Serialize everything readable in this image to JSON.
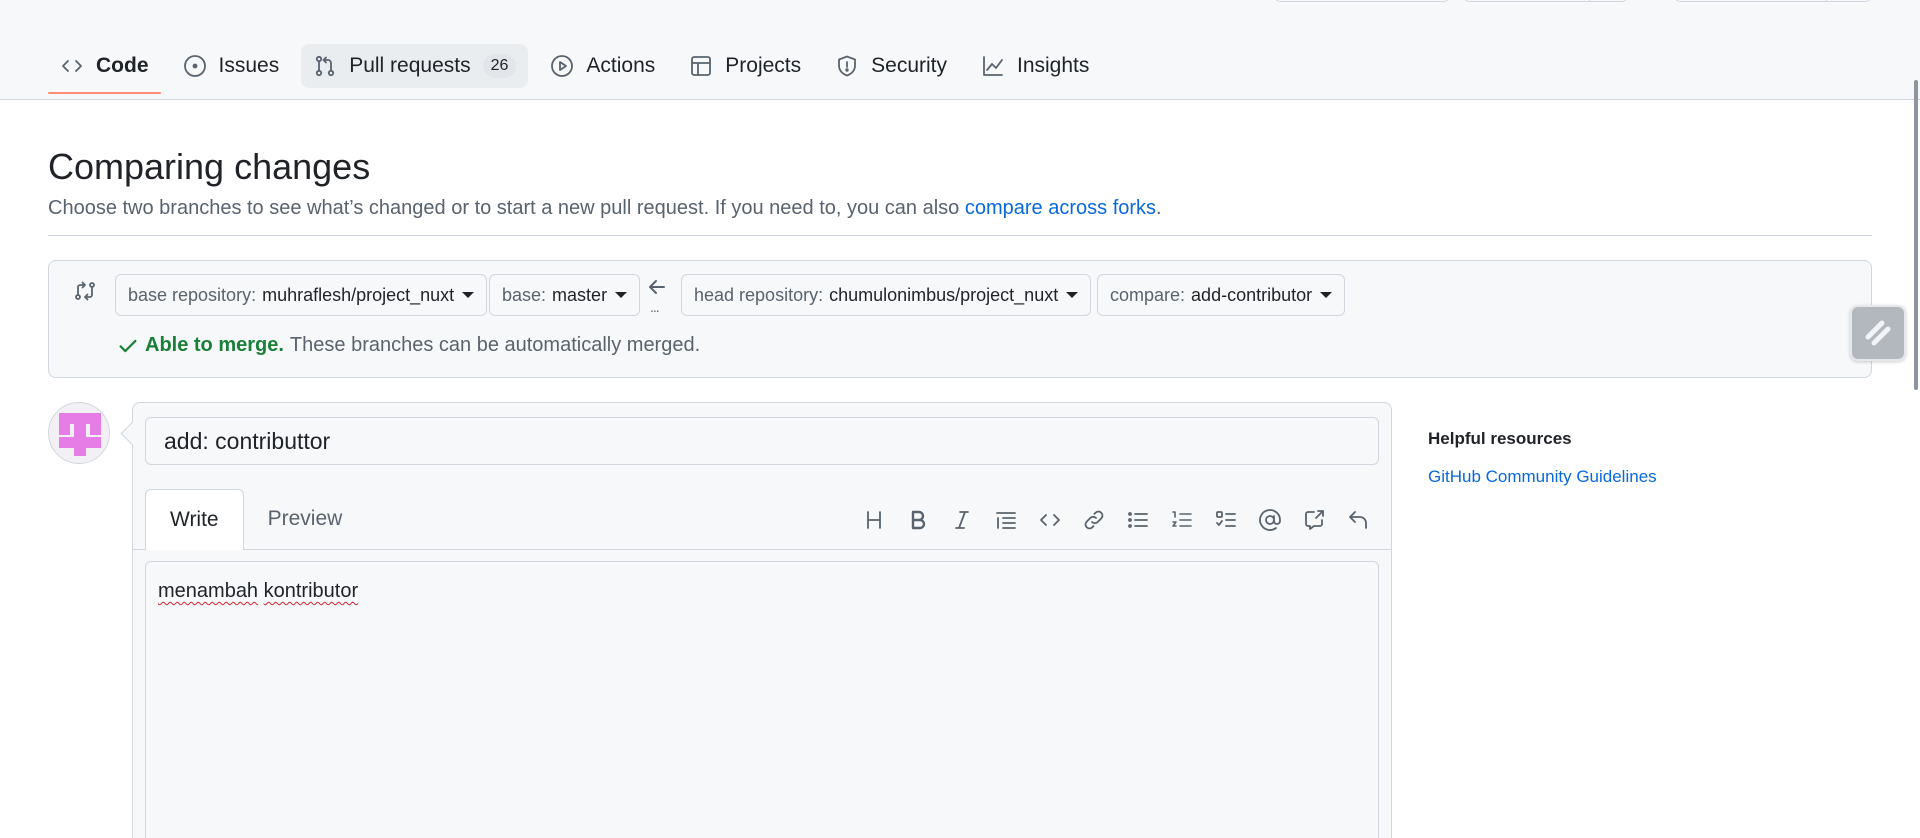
{
  "nav": {
    "items": [
      {
        "label": "Code",
        "icon": "code-icon"
      },
      {
        "label": "Issues",
        "icon": "issue-opened-icon"
      },
      {
        "label": "Pull requests",
        "icon": "git-pull-request-icon",
        "count": "26"
      },
      {
        "label": "Actions",
        "icon": "play-icon"
      },
      {
        "label": "Projects",
        "icon": "table-icon"
      },
      {
        "label": "Security",
        "icon": "shield-icon"
      },
      {
        "label": "Insights",
        "icon": "graph-icon"
      }
    ]
  },
  "header": {
    "title": "Comparing changes",
    "subtitle": "Choose two branches to see what’s changed or to start a new pull request. If you need to, you can also ",
    "subtitle_link": "compare across forks",
    "subtitle_end": "."
  },
  "range": {
    "base_repo_label": "base repository:",
    "base_repo_value": "muhraflesh/project_nuxt",
    "base_label": "base:",
    "base_value": "master",
    "swap_dots": "...",
    "head_repo_label": "head repository:",
    "head_repo_value": "chumulonimbus/project_nuxt",
    "compare_label": "compare:",
    "compare_value": "add-contributor",
    "merge_ok": "Able to merge.",
    "merge_text": "These branches can be automatically merged."
  },
  "composer": {
    "title_value": "add: contributtor",
    "tabs": [
      "Write",
      "Preview"
    ],
    "body_words": [
      "menambah",
      "kontributor"
    ],
    "toolbar": [
      "heading-icon",
      "bold-icon",
      "italic-icon",
      "quote-icon",
      "code-icon",
      "link-icon",
      "unordered-list-icon",
      "ordered-list-icon",
      "task-list-icon",
      "mention-icon",
      "cross-reference-icon",
      "undo-icon"
    ]
  },
  "sidebar": {
    "heading": "Helpful resources",
    "link": "GitHub Community Guidelines"
  },
  "colors": {
    "accent": "#0969da",
    "success": "#1a7f37",
    "nav_underline": "#fd8c73",
    "avatar": "#e67de6"
  }
}
